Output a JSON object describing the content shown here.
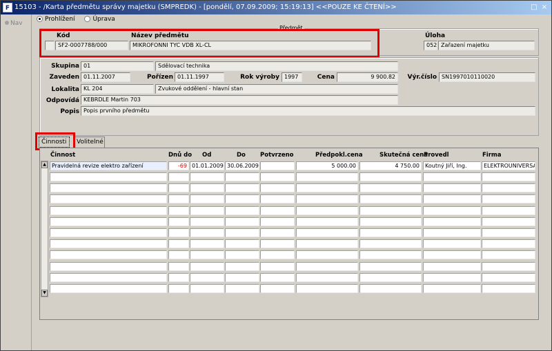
{
  "window": {
    "title": "15103 - /Karta předmětu správy majetku (SMPREDK) - [pondělí, 07.09.2009; 15:19:13] <<POUZE KE ČTENÍ>>",
    "app_icon_text": "F",
    "controls": [
      "□",
      "×"
    ]
  },
  "left_panel": {
    "nav_label": "Nav"
  },
  "mode": {
    "view_label": "Prohlížení",
    "edit_label": "Úprava",
    "selected": "view"
  },
  "predmet": {
    "group_title": "Předmět",
    "kod_label": "Kód",
    "nazev_label": "Název předmětu",
    "kod_value": "SF2-0007788/000",
    "nazev_value": "MIKROFONNI TYC VDB XL-CL",
    "uloha_label": "Úloha",
    "uloha_code": "052",
    "uloha_value": "Zařazení majetku"
  },
  "detail": {
    "skupina_label": "Skupina",
    "skupina_code": "01",
    "skupina_value": "Sdělovací technika",
    "zaveden_label": "Zaveden",
    "zaveden_value": "01.11.2007",
    "porizen_label": "Pořízen",
    "porizen_value": "01.11.1997",
    "rok_label": "Rok výroby",
    "rok_value": "1997",
    "cena_label": "Cena",
    "cena_value": "9 900.82",
    "vyr_label": "Výr.číslo",
    "vyr_value": "SN1997010110020",
    "lokalita_label": "Lokalita",
    "lokalita_code": "KL 204",
    "lokalita_value": "Zvukové oddělení - hlavní stan",
    "odpovida_label": "Odpovídá",
    "odpovida_value": "KEBRDLE Martin 703",
    "popis_label": "Popis",
    "popis_value": "Popis prvního předmětu"
  },
  "tabs": {
    "cinnosti": "Činnosti",
    "volitelne": "Volitelné"
  },
  "grid": {
    "columns": [
      "Činnost",
      "Dnů do",
      "Od",
      "Do",
      "Potvrzeno",
      "Předpokl.cena",
      "Skutečná cena",
      "Provedl",
      "Firma"
    ],
    "rows": [
      [
        "Pravidelná revize elektro zařízení",
        "-69",
        "01.01.2009",
        "30.06.2009",
        "",
        "5 000.00",
        "4 750.00",
        "Koutný Jiří, Ing.",
        "ELEKTROUNIVERSA"
      ]
    ],
    "empty_rows": 11
  },
  "colors": {
    "highlight": "#e00000",
    "negative": "#e00000",
    "title_start": "#0a246a"
  }
}
